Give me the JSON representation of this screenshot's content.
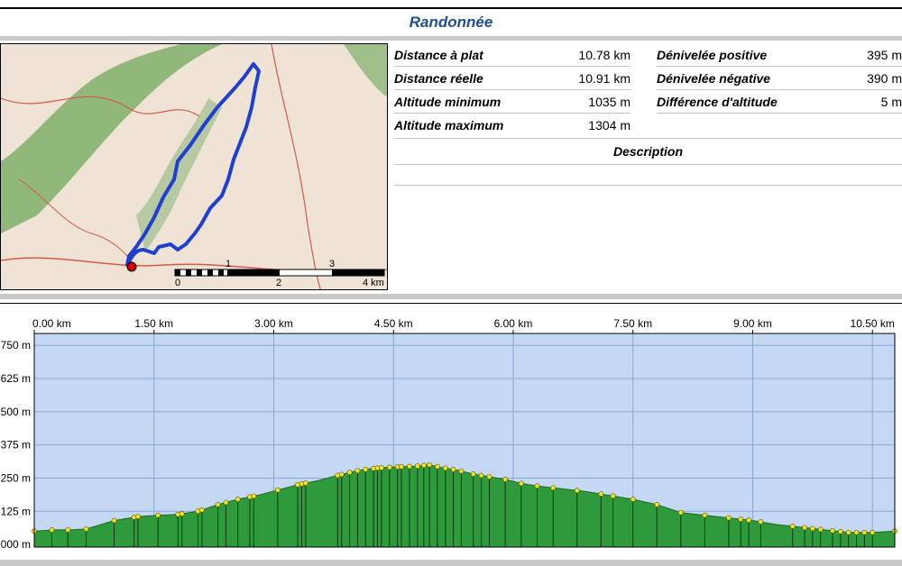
{
  "page": {
    "title": "Randonnée"
  },
  "stats": {
    "left": [
      {
        "label": "Distance à plat",
        "value": "10.78 km"
      },
      {
        "label": "Distance réelle",
        "value": "10.91 km"
      },
      {
        "label": "Altitude minimum",
        "value": "1035 m"
      },
      {
        "label": "Altitude maximum",
        "value": "1304 m"
      }
    ],
    "right": [
      {
        "label": "Dénivelée positive",
        "value": "395 m"
      },
      {
        "label": "Dénivelée négative",
        "value": "390 m"
      },
      {
        "label": "Différence d'altitude",
        "value": "5 m"
      }
    ]
  },
  "description": {
    "title": "Description"
  },
  "map": {
    "scale_labels_top": [
      "1",
      "3"
    ],
    "scale_labels_bottom": [
      "0",
      "2",
      "4 km"
    ],
    "route_color": "#1f3fd0",
    "start_marker_color": "#d00000",
    "colors": {
      "terrain": "#efe3d6",
      "forest": "#7fb06a",
      "roads": "#d45a4a"
    }
  },
  "chart_data": {
    "type": "area",
    "title": "",
    "xlabel": "",
    "ylabel": "",
    "x_unit": "km",
    "y_unit": "m",
    "xlim": [
      0,
      10.78
    ],
    "ylim": [
      -10,
      795
    ],
    "x_ticks": [
      "0.00 km",
      "1.50 km",
      "3.00 km",
      "4.50 km",
      "6.00 km",
      "7.50 km",
      "9.00 km",
      "10.50 km"
    ],
    "x_tick_values": [
      0,
      1.5,
      3.0,
      4.5,
      6.0,
      7.5,
      9.0,
      10.5
    ],
    "y_ticks": [
      "750 m",
      "625 m",
      "500 m",
      "375 m",
      "250 m",
      "125 m",
      "000 m"
    ],
    "y_tick_values": [
      750,
      625,
      500,
      375,
      250,
      125,
      0
    ],
    "grid": true,
    "colors": {
      "fill": "#2e9a3c",
      "background": "#c4d8f4",
      "waypoint": "#f2e12a",
      "grid": "#8aa6d0"
    },
    "series": [
      {
        "x": [
          0,
          0.25,
          0.45,
          0.65,
          1.0,
          1.3,
          1.55,
          1.8,
          2.05,
          2.3,
          2.55,
          2.8,
          3.05,
          3.3,
          3.55,
          3.8,
          4.0,
          4.2,
          4.4,
          4.6,
          4.8,
          4.95,
          5.1,
          5.3,
          5.5,
          5.7,
          5.9,
          6.1,
          6.3,
          6.6,
          6.9,
          7.2,
          7.5,
          7.8,
          8.1,
          8.4,
          8.7,
          9.0,
          9.3,
          9.6,
          9.9,
          10.2,
          10.5,
          10.78
        ],
        "y": [
          50,
          55,
          55,
          58,
          90,
          105,
          110,
          113,
          125,
          150,
          170,
          185,
          205,
          225,
          240,
          260,
          275,
          285,
          290,
          293,
          295,
          300,
          290,
          280,
          265,
          255,
          245,
          230,
          220,
          210,
          200,
          185,
          170,
          150,
          120,
          110,
          100,
          90,
          75,
          65,
          55,
          45,
          45,
          50
        ]
      }
    ],
    "waypoints_x": [
      0,
      0.22,
      0.42,
      0.65,
      1.0,
      1.25,
      1.3,
      1.55,
      1.8,
      1.85,
      2.05,
      2.1,
      2.3,
      2.4,
      2.55,
      2.7,
      2.75,
      3.05,
      3.3,
      3.35,
      3.4,
      3.8,
      3.85,
      3.95,
      4.05,
      4.15,
      4.25,
      4.3,
      4.35,
      4.45,
      4.55,
      4.6,
      4.7,
      4.8,
      4.88,
      4.95,
      5.05,
      5.15,
      5.25,
      5.35,
      5.5,
      5.6,
      5.7,
      5.9,
      6.1,
      6.3,
      6.5,
      6.8,
      7.1,
      7.25,
      7.5,
      7.8,
      8.1,
      8.4,
      8.7,
      8.85,
      8.95,
      9.1,
      9.5,
      9.65,
      9.75,
      9.85,
      10.0,
      10.1,
      10.2,
      10.3,
      10.4,
      10.5,
      10.78
    ],
    "waypoint_marker_color": "#f2e12a"
  }
}
